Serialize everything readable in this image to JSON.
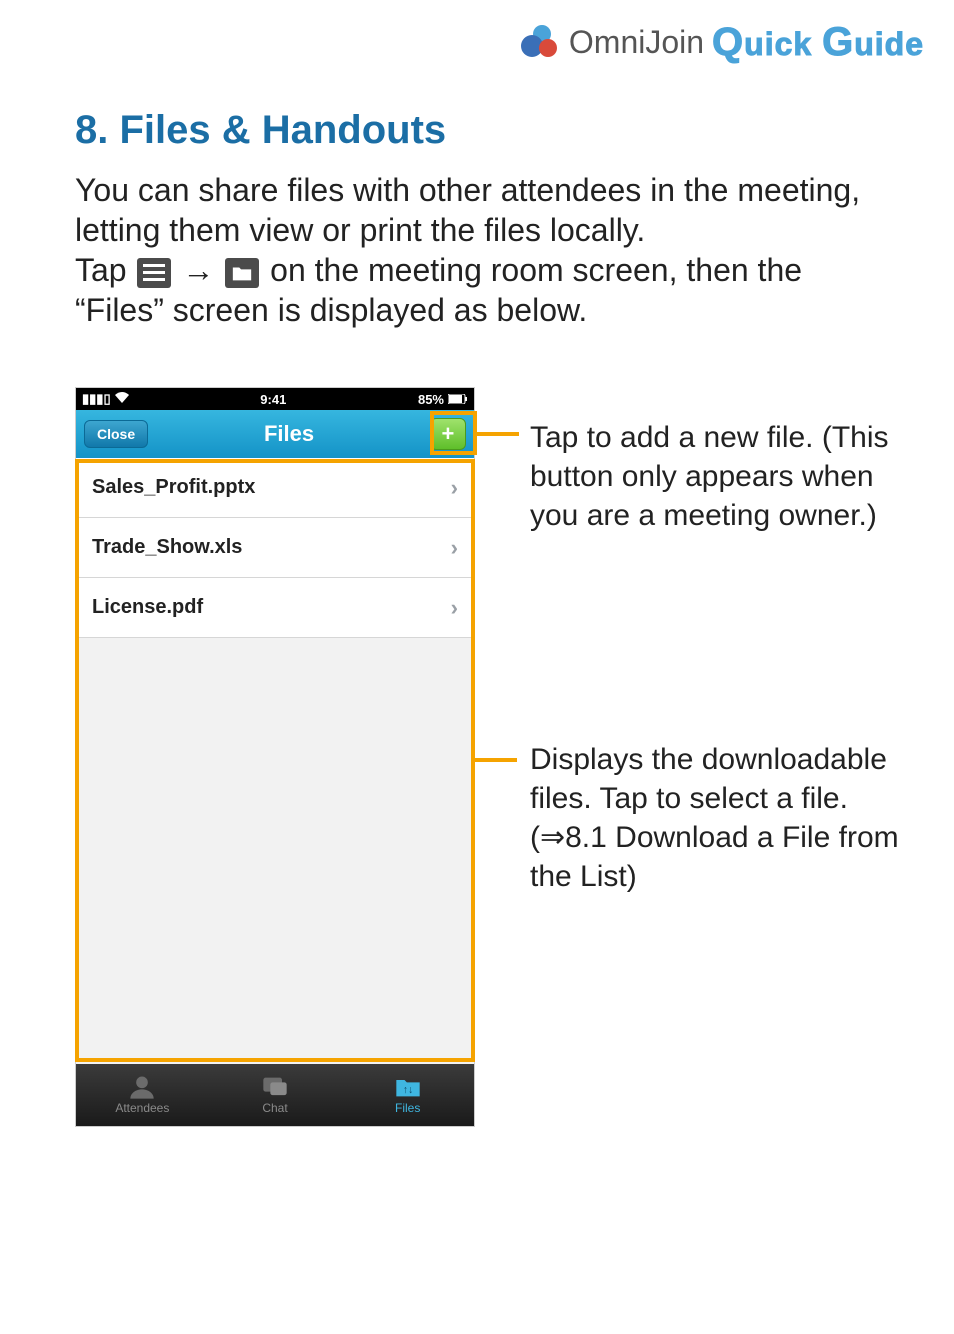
{
  "header": {
    "brand": "OmniJoin",
    "guide": "Quick Guide"
  },
  "section": {
    "title": "8. Files & Handouts",
    "intro_line1": "You can share files with other attendees in the meeting, letting them view or print the files locally.",
    "tap_prefix": "Tap ",
    "tap_mid": " → ",
    "tap_suffix": " on the meeting room screen, then the “Files” screen is displayed as below."
  },
  "phone": {
    "status": {
      "time": "9:41",
      "battery": "85%"
    },
    "nav": {
      "close": "Close",
      "title": "Files",
      "add": "+"
    },
    "files": [
      "Sales_Profit.pptx",
      "Trade_Show.xls",
      "License.pdf"
    ],
    "tabs": {
      "attendees": "Attendees",
      "chat": "Chat",
      "files": "Files"
    }
  },
  "callouts": {
    "add": "Tap to add a new file. (This button only appears when you are a meeting owner.)",
    "list": "Displays the downloadable files. Tap to select a file. (⇒8.1 Download a File from the List)"
  }
}
